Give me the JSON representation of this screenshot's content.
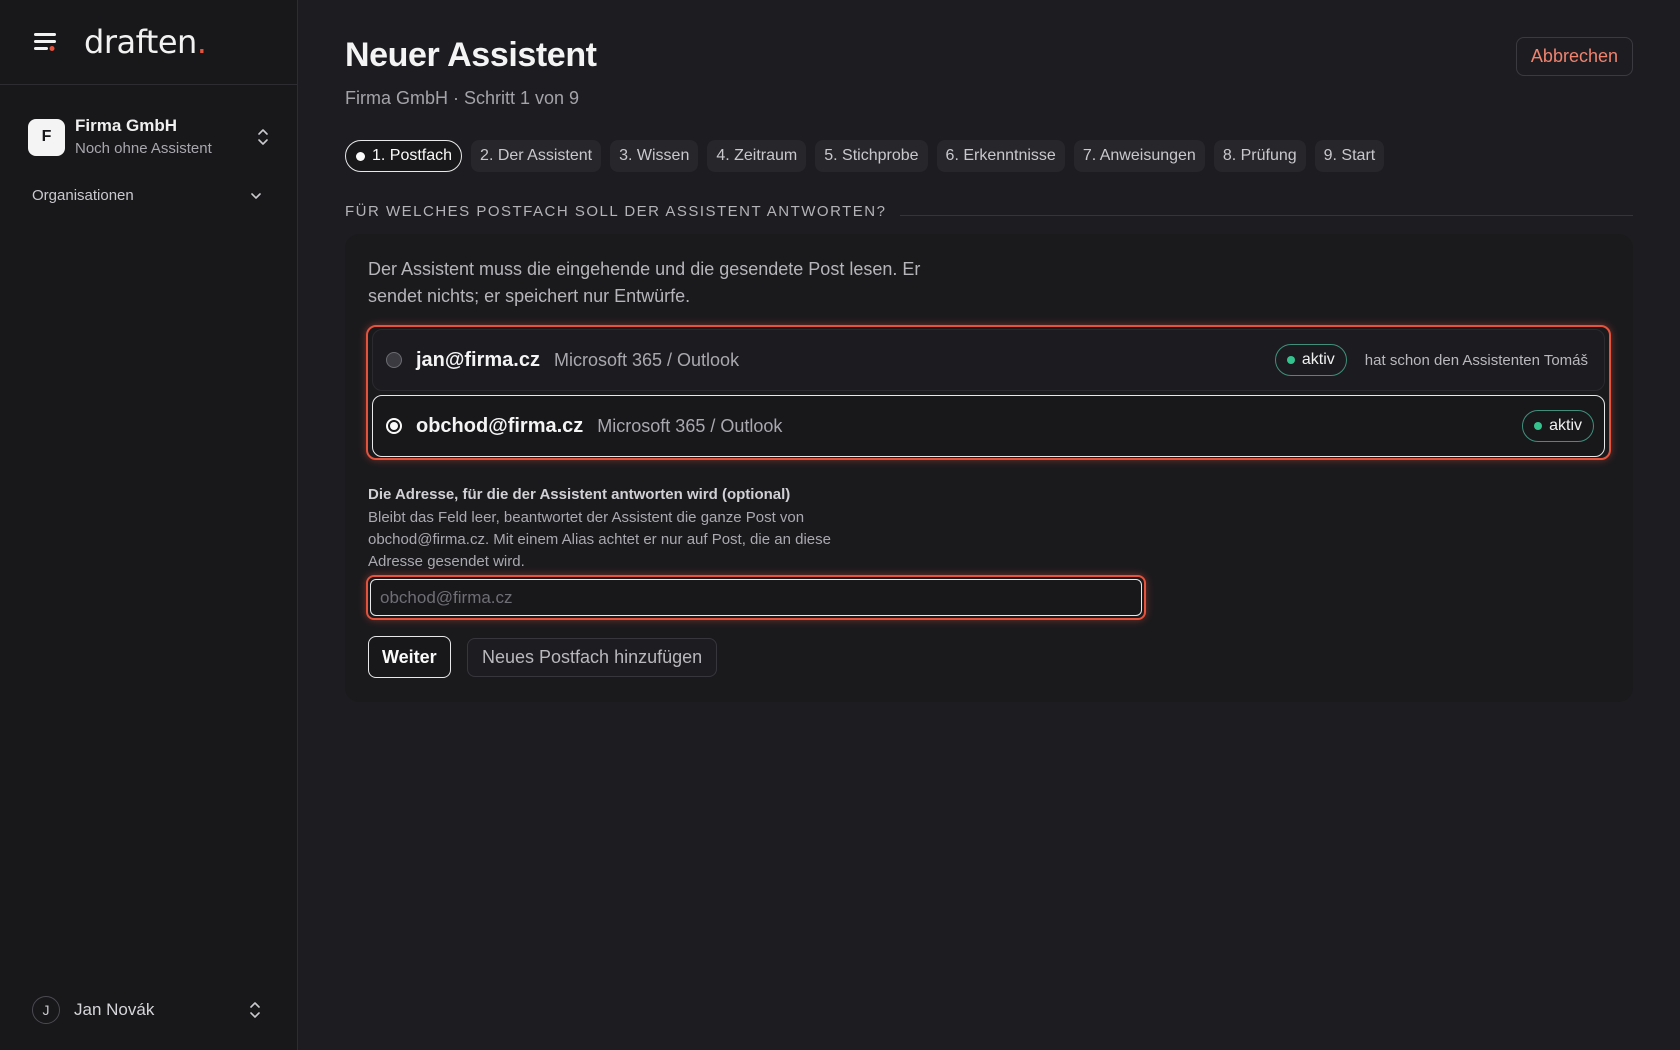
{
  "app": {
    "logo_text": "draften",
    "logo_dot": ".",
    "accent_color": "#e5533d"
  },
  "sidebar": {
    "org": {
      "avatar_letter": "F",
      "name": "Firma GmbH",
      "subtitle": "Noch ohne Assistent"
    },
    "nav_group_label": "Organisationen",
    "user": {
      "avatar_letter": "J",
      "name": "Jan Novák"
    }
  },
  "header": {
    "title": "Neuer Assistent",
    "subtitle": "Firma GmbH · Schritt 1 von 9",
    "cancel_label": "Abbrechen"
  },
  "steps": [
    {
      "label": "1. Postfach",
      "active": true
    },
    {
      "label": "2. Der Assistent"
    },
    {
      "label": "3. Wissen"
    },
    {
      "label": "4. Zeitraum"
    },
    {
      "label": "5. Stichprobe"
    },
    {
      "label": "6. Erkenntnisse"
    },
    {
      "label": "7. Anweisungen"
    },
    {
      "label": "8. Prüfung"
    },
    {
      "label": "9. Start"
    }
  ],
  "section": {
    "heading": "FÜR WELCHES POSTFACH SOLL DER ASSISTENT ANTWORTEN?"
  },
  "card": {
    "intro": "Der Assistent muss die eingehende und die gesendete Post lesen. Er sendet nichts; er speichert nur Entwürfe.",
    "mailboxes": [
      {
        "address": "jan@firma.cz",
        "provider": "Microsoft 365 / Outlook",
        "status": "aktiv",
        "note": "hat schon den Assistenten Tomáš",
        "selected": false
      },
      {
        "address": "obchod@firma.cz",
        "provider": "Microsoft 365 / Outlook",
        "status": "aktiv",
        "selected": true
      }
    ],
    "alias_field": {
      "label": "Die Adresse, für die der Assistent antworten wird (optional)",
      "help": "Bleibt das Feld leer, beantwortet der Assistent die ganze Post von obchod@firma.cz. Mit einem Alias achtet er nur auf Post, die an diese Adresse gesendet wird.",
      "placeholder": "obchod@firma.cz",
      "value": ""
    },
    "next_label": "Weiter",
    "add_mailbox_label": "Neues Postfach hinzufügen"
  }
}
